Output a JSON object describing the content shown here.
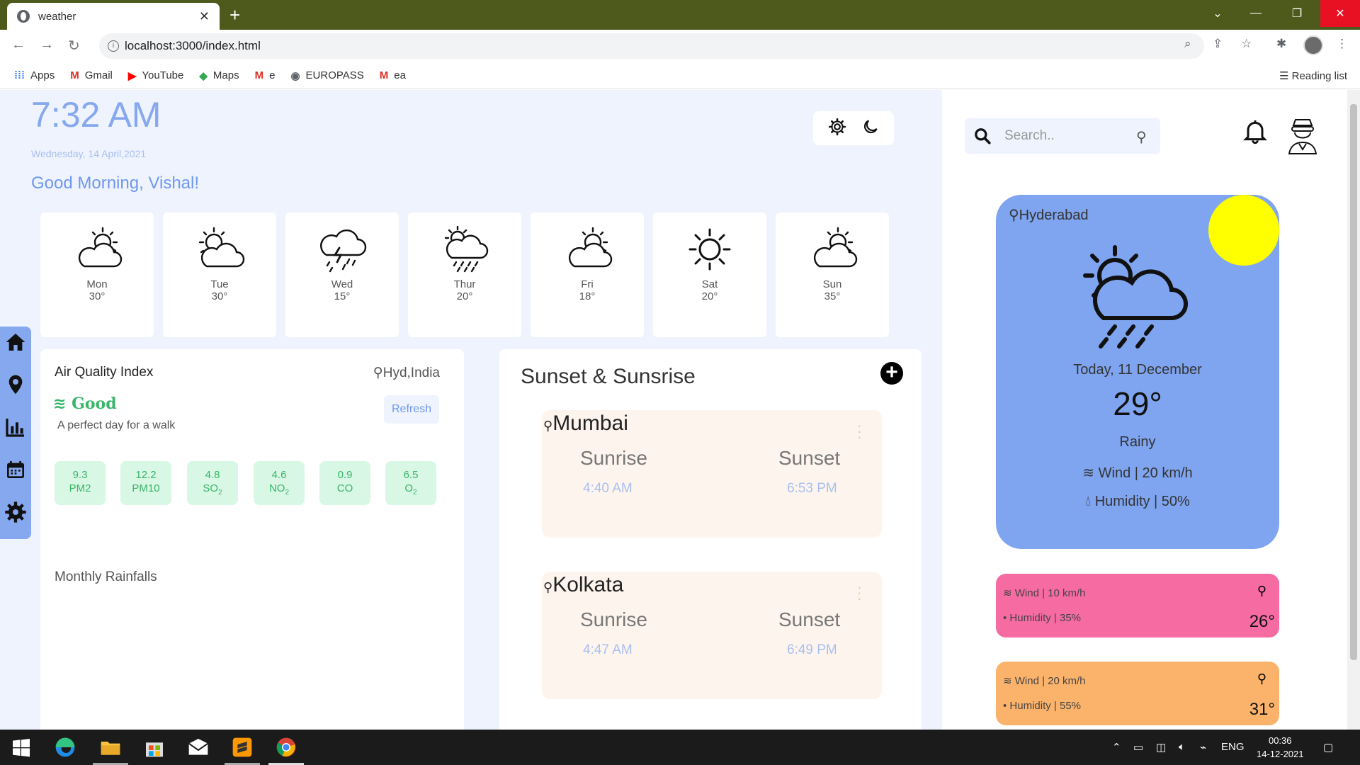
{
  "browser": {
    "tab_title": "weather",
    "url": "localhost:3000/index.html",
    "bookmarks": [
      "Apps",
      "Gmail",
      "YouTube",
      "Maps",
      "e",
      "EUROPASS",
      "ea"
    ],
    "reading_list": "Reading list"
  },
  "header": {
    "time": "7:32 AM",
    "date": "Wednesday, 14 April,2021",
    "greeting": "Good Morning, Vishal!"
  },
  "forecast": [
    {
      "day": "Mon",
      "temp": "30°",
      "icon": "sun-cloud-icon"
    },
    {
      "day": "Tue",
      "temp": "30°",
      "icon": "sun-cloud-icon"
    },
    {
      "day": "Wed",
      "temp": "15°",
      "icon": "thunderstorm-icon"
    },
    {
      "day": "Thur",
      "temp": "20°",
      "icon": "sun-rain-icon"
    },
    {
      "day": "Fri",
      "temp": "18°",
      "icon": "sun-cloud-icon"
    },
    {
      "day": "Sat",
      "temp": "20°",
      "icon": "sun-icon"
    },
    {
      "day": "Sun",
      "temp": "35°",
      "icon": "sun-cloud-icon"
    }
  ],
  "aqi": {
    "title": "Air Quality Index",
    "location": "Hyd,India",
    "status": "Good",
    "description": "A perfect day for a walk",
    "refresh_label": "Refresh",
    "pollutants": [
      {
        "value": "9.3",
        "name": "PM2",
        "sub": ""
      },
      {
        "value": "12.2",
        "name": "PM10",
        "sub": ""
      },
      {
        "value": "4.8",
        "name": "SO",
        "sub": "2"
      },
      {
        "value": "4.6",
        "name": "NO",
        "sub": "2"
      },
      {
        "value": "0.9",
        "name": "CO",
        "sub": ""
      },
      {
        "value": "6.5",
        "name": "O",
        "sub": "2"
      }
    ]
  },
  "rainfall": {
    "title": "Monthly Rainfalls"
  },
  "sun": {
    "title": "Sunset & Sunsrise",
    "cities": [
      {
        "name": "Mumbai",
        "sunrise_label": "Sunrise",
        "sunset_label": "Sunset",
        "sunrise": "4:40 AM",
        "sunset": "6:53 PM"
      },
      {
        "name": "Kolkata",
        "sunrise_label": "Sunrise",
        "sunset_label": "Sunset",
        "sunrise": "4:47 AM",
        "sunset": "6:49 PM"
      }
    ]
  },
  "right": {
    "search_placeholder": "Search..",
    "current": {
      "location": "Hyderabad",
      "date": "Today, 11 December",
      "temp": "29°",
      "condition": "Rainy",
      "wind": "Wind | 20 km/h",
      "humidity": "Humidity | 50%"
    },
    "cards": [
      {
        "wind": "Wind  |  10  km/h",
        "humidity": "Humidity  |  35%",
        "temp": "26°",
        "color": "#f76ba3"
      },
      {
        "wind": "Wind  |  20  km/h",
        "humidity": "Humidity  |  55%",
        "temp": "31°",
        "color": "#fbb36b"
      }
    ]
  },
  "taskbar": {
    "lang": "ENG",
    "time": "00:36",
    "date": "14-12-2021"
  },
  "colors": {
    "accent": "#86a8ef",
    "good": "#39b56a",
    "card_bg": "#fdf5ed"
  }
}
